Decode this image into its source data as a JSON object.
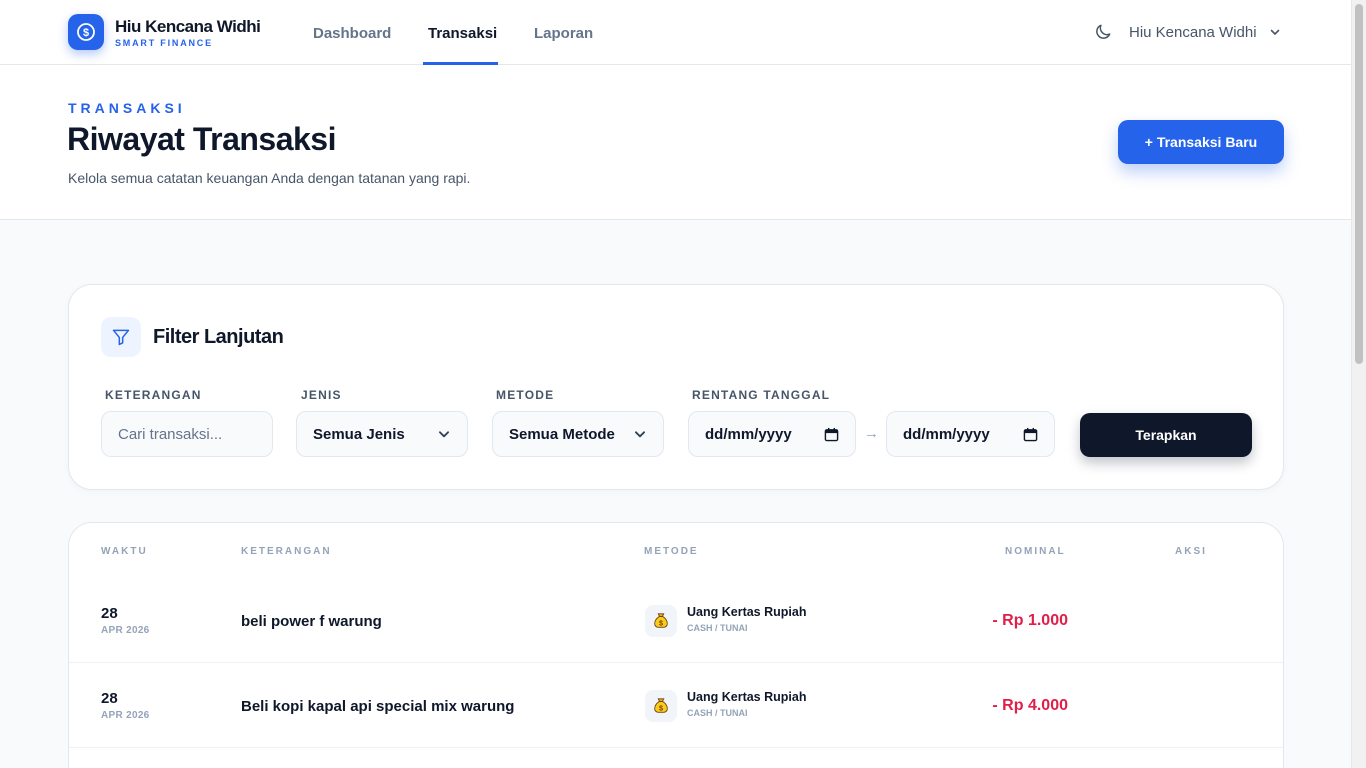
{
  "brand": {
    "name": "Hiu Kencana Widhi",
    "tagline": "SMART FINANCE",
    "logo_icon": "dollar-coin-icon"
  },
  "nav": {
    "items": [
      {
        "label": "Dashboard",
        "active": false
      },
      {
        "label": "Transaksi",
        "active": true
      },
      {
        "label": "Laporan",
        "active": false
      }
    ],
    "theme_toggle_icon": "moon-icon",
    "user_name": "Hiu Kencana Widhi"
  },
  "header": {
    "eyebrow": "TRANSAKSI",
    "title": "Riwayat Transaksi",
    "subtitle": "Kelola semua catatan keuangan Anda dengan tatanan yang rapi.",
    "new_button": "+ Transaksi Baru"
  },
  "filter": {
    "title": "Filter Lanjutan",
    "icon": "funnel-icon",
    "keterangan_label": "KETERANGAN",
    "keterangan_placeholder": "Cari transaksi...",
    "jenis_label": "JENIS",
    "jenis_value": "Semua Jenis",
    "metode_label": "METODE",
    "metode_value": "Semua Metode",
    "tanggal_label": "RENTANG TANGGAL",
    "date_from": "dd/mm/yyyy",
    "date_to": "dd/mm/yyyy",
    "date_separator": "→",
    "apply_button": "Terapkan"
  },
  "table": {
    "columns": {
      "waktu": "WAKTU",
      "keterangan": "KETERANGAN",
      "metode": "METODE",
      "nominal": "NOMINAL",
      "aksi": "AKSI"
    },
    "rows": [
      {
        "day": "28",
        "month": "APR 2026",
        "description": "beli power f warung",
        "method_name": "Uang Kertas Rupiah",
        "method_sub": "CASH / TUNAI",
        "method_icon": "money-bag-icon",
        "amount": "- Rp 1.000"
      },
      {
        "day": "28",
        "month": "APR 2026",
        "description": "Beli kopi kapal api special mix warung",
        "method_name": "Uang Kertas Rupiah",
        "method_sub": "CASH / TUNAI",
        "method_icon": "money-bag-icon",
        "amount": "- Rp 4.000"
      }
    ]
  },
  "colors": {
    "primary": "#2563eb",
    "dark": "#0f172a",
    "expense": "#e11d48",
    "muted": "#94a3b8"
  }
}
